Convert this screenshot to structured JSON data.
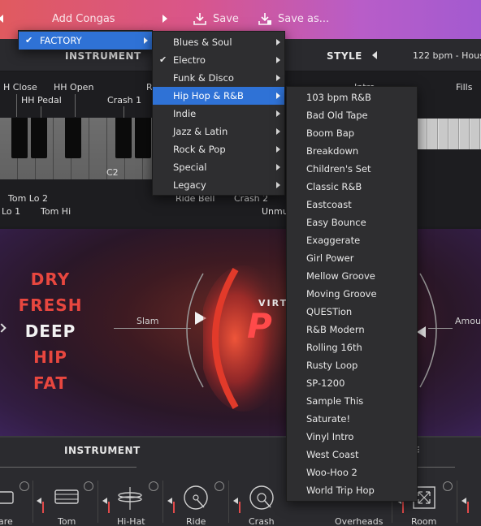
{
  "toolbar": {
    "add_congas": "Add Congas",
    "save": "Save",
    "save_as": "Save as..."
  },
  "header": {
    "instrument": "INSTRUMENT",
    "style": "STYLE",
    "bpm": "122 bpm - Hous"
  },
  "keyboard_labels": {
    "hh_close": "H Close",
    "hh_open": "HH Open",
    "hh_pedal": "HH Pedal",
    "crash1": "Crash 1",
    "c2": "C2",
    "tom_lo2": "Tom Lo 2",
    "lo1": "Lo 1",
    "tom_hi": "Tom Hi",
    "ride_bell": "Ride Bell",
    "crash2": "Crash 2",
    "unmu": "Unmu",
    "r": "R",
    "intro": "Intro",
    "fills": "Fills"
  },
  "hero": {
    "styles": [
      "DRY",
      "FRESH",
      "DEEP",
      "HIP",
      "FAT"
    ],
    "selected_style": "DEEP",
    "slam": "Slam",
    "amount": "Amou",
    "virt": "VIRT",
    "logo": "P"
  },
  "mixer": {
    "title": "INSTRUMENT",
    "channels": [
      "are",
      "Tom",
      "Hi-Hat",
      "Ride",
      "Crash",
      "Overheads",
      "Room"
    ]
  },
  "menus": {
    "level1": {
      "items": [
        {
          "label": "FACTORY",
          "checked": true,
          "selected": true
        }
      ]
    },
    "level2": {
      "items": [
        {
          "label": "Blues & Soul",
          "checked": false,
          "selected": false
        },
        {
          "label": "Electro",
          "checked": true,
          "selected": false
        },
        {
          "label": "Funk & Disco",
          "checked": false,
          "selected": false
        },
        {
          "label": "Hip Hop & R&B",
          "checked": false,
          "selected": true
        },
        {
          "label": "Indie",
          "checked": false,
          "selected": false
        },
        {
          "label": "Jazz & Latin",
          "checked": false,
          "selected": false
        },
        {
          "label": "Rock & Pop",
          "checked": false,
          "selected": false
        },
        {
          "label": "Special",
          "checked": false,
          "selected": false
        },
        {
          "label": "Legacy",
          "checked": false,
          "selected": false
        }
      ]
    },
    "level3": {
      "items": [
        "103 bpm R&B",
        "Bad Old Tape",
        "Boom Bap",
        "Breakdown",
        "Children's Set",
        "Classic R&B",
        "Eastcoast",
        "Easy Bounce",
        "Exaggerate",
        "Girl Power",
        "Mellow Groove",
        "Moving Groove",
        "QUESTion",
        "R&B Modern",
        "Rolling 16th",
        "Rusty Loop",
        "SP-1200",
        "Sample This",
        "Saturate!",
        "Vinyl Intro",
        "West Coast",
        "Woo-Hoo 2",
        "World Trip Hop"
      ]
    }
  },
  "colors": {
    "accent": "#2f72d6",
    "style_red": "#e8473f",
    "style_white": "#f2f2f2"
  }
}
